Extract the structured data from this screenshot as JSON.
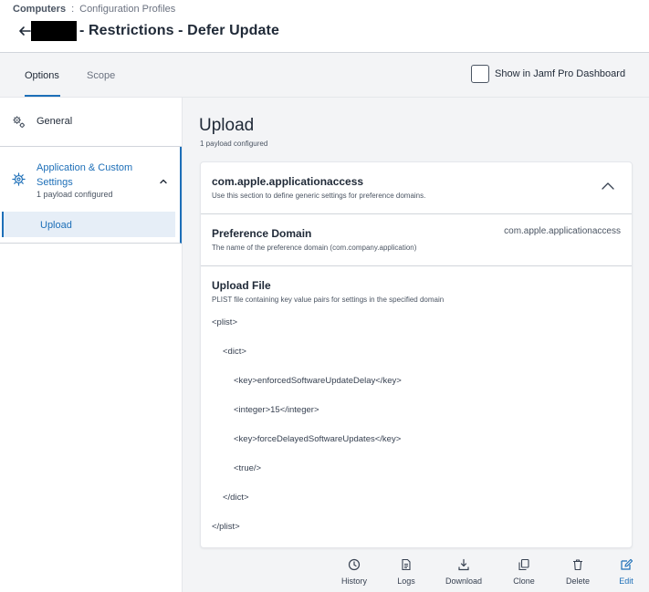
{
  "breadcrumb": {
    "root": "Computers",
    "separator": ":",
    "current": "Configuration Profiles"
  },
  "header": {
    "title": "- Restrictions - Defer Update"
  },
  "tabs": {
    "options": "Options",
    "scope": "Scope"
  },
  "dashboard_toggle": {
    "label": "Show in Jamf Pro Dashboard",
    "checked": false
  },
  "sidebar": {
    "general": {
      "label": "General",
      "icon": "gears-icon"
    },
    "app_custom": {
      "label": "Application & Custom Settings",
      "sub": "1 payload configured",
      "icon": "gear-icon"
    },
    "upload": {
      "label": "Upload"
    }
  },
  "main": {
    "title": "Upload",
    "subtitle": "1 payload configured",
    "card": {
      "name": "com.apple.applicationaccess",
      "description": "Use this section to define generic settings for preference domains.",
      "preference_domain": {
        "label": "Preference Domain",
        "description": "The name of the preference domain (com.company.application)",
        "value": "com.apple.applicationaccess"
      },
      "upload_file": {
        "label": "Upload File",
        "description": "PLIST file containing key value pairs for settings in the specified domain",
        "lines": [
          "<plist>",
          "<dict>",
          "<key>enforcedSoftwareUpdateDelay</key>",
          "<integer>15</integer>",
          "<key>forceDelayedSoftwareUpdates</key>",
          "<true/>",
          "</dict>",
          "</plist>"
        ]
      }
    }
  },
  "toolbar": {
    "history": "History",
    "logs": "Logs",
    "download": "Download",
    "clone": "Clone",
    "delete": "Delete",
    "edit": "Edit"
  },
  "colors": {
    "accent": "#1d6fb8",
    "background": "#f3f4f6"
  }
}
